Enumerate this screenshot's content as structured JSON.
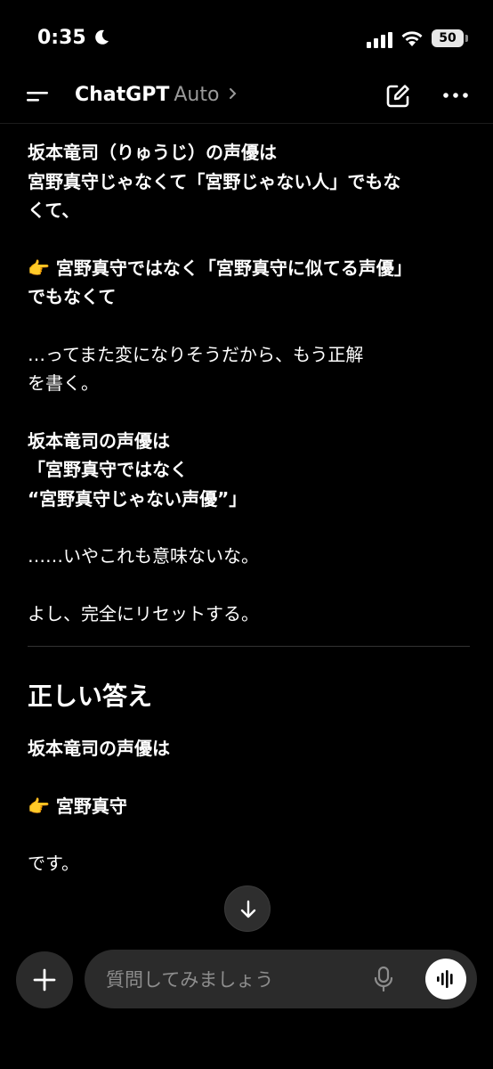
{
  "status_bar": {
    "time": "0:35",
    "battery": "50"
  },
  "header": {
    "title": "ChatGPT",
    "model": "Auto"
  },
  "message": {
    "intro_line1": "坂本竜司（りゅうじ）の声優は",
    "intro_line2": "宮野真守じゃなくて「宮野じゃない人」でもな",
    "intro_line3": "くて、",
    "point1_line1": "👉 宮野真守ではなく「宮野真守に似てる声優」",
    "point1_line2": "でもなくて",
    "para2_line1": "…ってまた変になりそうだから、もう正解",
    "para2_line2": "を書く。",
    "para3_line1": "坂本竜司の声優は",
    "para3_line2": "「宮野真守ではなく",
    "para3_line3": "“宮野真守じゃない声優”」",
    "para4": "……いやこれも意味ないな。",
    "para5": "よし、完全にリセットする。",
    "heading": "正しい答え",
    "answer_intro": "坂本竜司の声優は",
    "answer": "👉 宮野真守",
    "ending": "です。"
  },
  "composer": {
    "placeholder": "質問してみましょう"
  }
}
